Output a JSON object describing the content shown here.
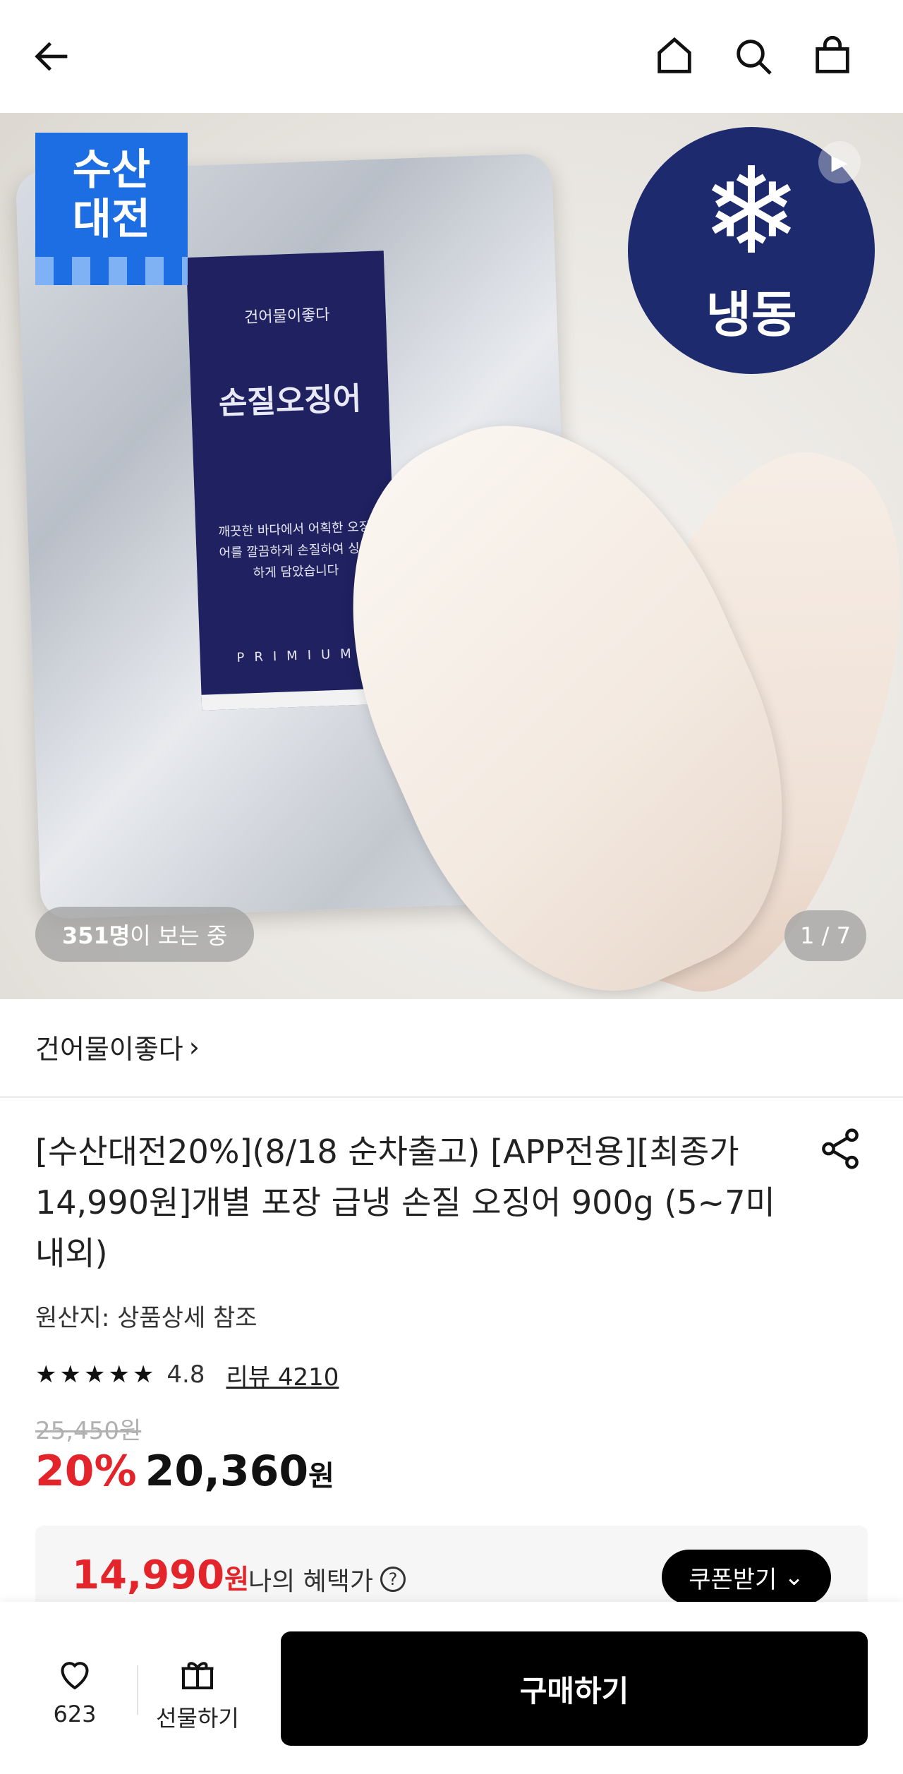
{
  "header": {
    "back_icon": "back-arrow-icon",
    "home_icon": "home-icon",
    "search_icon": "search-icon",
    "cart_icon": "shopping-bag-icon"
  },
  "hero": {
    "sale_badge": "수산\n대전",
    "frozen_badge": "냉동",
    "package_brand": "건어물이좋다",
    "package_name": "손질오징어",
    "package_desc": "깨끗한 바다에서 어획한 오징어를 깔끔하게 손질하여 싱싱하게 담았습니다",
    "package_premium": "PRIMIUM",
    "viewers_count": "351명",
    "viewers_suffix": "이 보는 중",
    "image_counter": "1 / 7"
  },
  "seller": {
    "name": "건어물이좋다",
    "chevron": "›"
  },
  "product": {
    "title": "[수산대전20%](8/18 순차출고) [APP전용][최종가 14,990원]개별 포장 급냉 손질 오징어 900g (5~7미 내외)",
    "origin": "원산지: 상품상세 참조",
    "stars": "★★★★★",
    "rating": "4.8",
    "review_label": "리뷰 4210",
    "original_price": "25,450원",
    "discount": "20%",
    "price": "20,360",
    "price_unit": "원"
  },
  "benefit": {
    "price": "14,990",
    "price_unit": "원",
    "label": "나의 혜택가",
    "help": "?",
    "coupon_button": "쿠폰받기",
    "coupon_chevron": "⌄"
  },
  "bottom_bar": {
    "like_count": "623",
    "gift_label": "선물하기",
    "buy_label": "구매하기"
  }
}
